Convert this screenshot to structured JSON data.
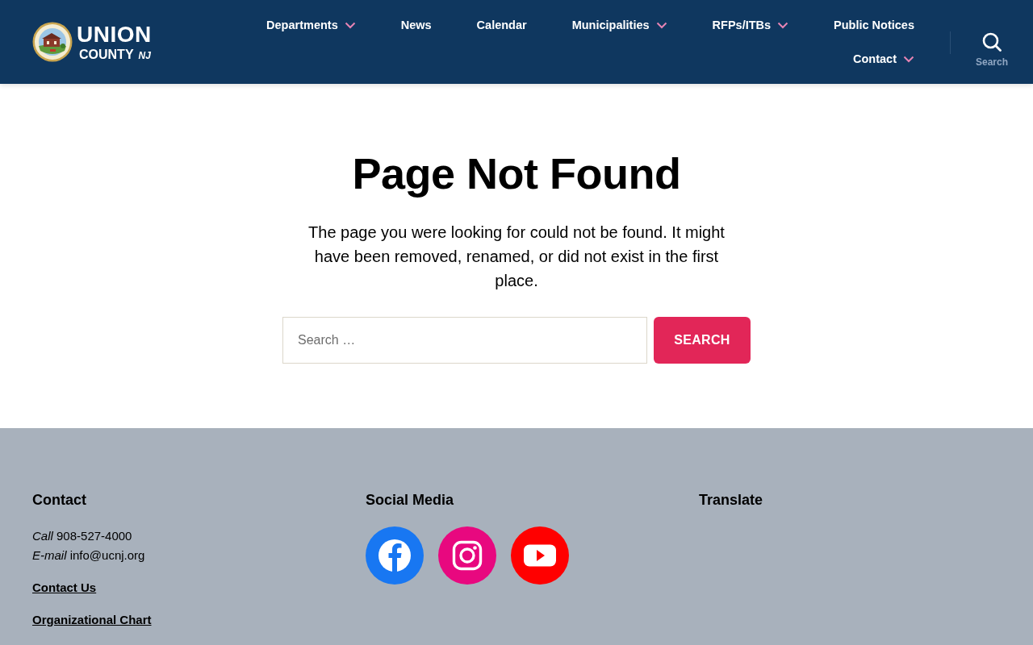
{
  "header": {
    "logo": {
      "title": "UNION",
      "subtitle": "COUNTY",
      "state": "NJ"
    },
    "nav": [
      {
        "label": "Departments",
        "has_submenu": true
      },
      {
        "label": "News",
        "has_submenu": false
      },
      {
        "label": "Calendar",
        "has_submenu": false
      },
      {
        "label": "Municipalities",
        "has_submenu": true
      },
      {
        "label": "RFPs/ITBs",
        "has_submenu": true
      },
      {
        "label": "Public Notices",
        "has_submenu": false
      },
      {
        "label": "Contact",
        "has_submenu": true
      }
    ],
    "search_toggle": {
      "label": "Search"
    }
  },
  "main": {
    "title": "Page Not Found",
    "message": "The page you were looking for could not be found. It might have been removed, renamed, or did not exist in the first place.",
    "search": {
      "placeholder": "Search …",
      "button": "SEARCH"
    }
  },
  "footer": {
    "columns": [
      {
        "kind": "contact",
        "heading": "Contact",
        "lines": [
          "*Call* 908-527-4000",
          "*E-mail* info@ucnj.org"
        ],
        "links": [
          "Contact Us",
          "Organizational Chart"
        ]
      },
      {
        "kind": "social",
        "heading": "Social Media",
        "social": [
          {
            "kind": "facebook",
            "color": "#1877f2"
          },
          {
            "kind": "instagram",
            "color": "#e8087f"
          },
          {
            "kind": "youtube",
            "color": "#ff0000"
          }
        ]
      },
      {
        "kind": "translate",
        "heading": "Translate"
      }
    ]
  }
}
